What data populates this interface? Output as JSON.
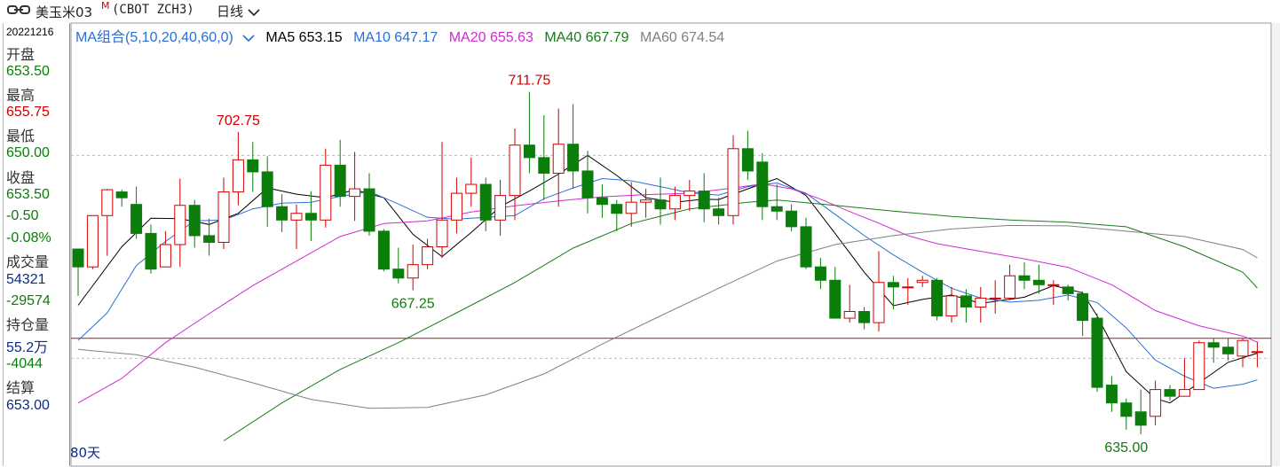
{
  "header": {
    "name": "美玉米03",
    "flag": "M",
    "code": "(CBOT ZCH3)",
    "period": "日线",
    "link_icon": "link-icon",
    "dropdown_icon": "chevron-down-icon"
  },
  "info_panel": {
    "date": "20221216",
    "open_label": "开盘",
    "open": "653.50",
    "high_label": "最高",
    "high": "655.75",
    "low_label": "最低",
    "low": "650.00",
    "close_label": "收盘",
    "close": "653.50",
    "change": "-0.50",
    "change_pct": "-0.08%",
    "volume_label": "成交量",
    "volume": "54321",
    "volume_change": "-29574",
    "oi_label": "持仓量",
    "oi": "55.2万",
    "oi_change": "-4044",
    "settle_label": "结算",
    "settle": "653.00"
  },
  "legend": {
    "selector": "MA组合(5,10,20,40,60,0)",
    "ma5": "MA5 653.15",
    "ma10": "MA10 647.17",
    "ma20": "MA20 655.63",
    "ma40": "MA40 667.79",
    "ma60": "MA60 674.54"
  },
  "footer": {
    "days": "80天"
  },
  "colors": {
    "up": "#d00000",
    "down": "#0a7d0a",
    "ma5": "#000000",
    "ma10": "#2a6fd6",
    "ma20": "#d12bd1",
    "ma40": "#1a7a1a",
    "ma60": "#808080",
    "ref_line": "#9c1c1c"
  },
  "chart_data": {
    "type": "candlestick",
    "y_range": [
      633,
      722
    ],
    "reference_price": 656.5,
    "grid_y": [
      697.5,
      652.0
    ],
    "annotations": [
      {
        "label": "702.75",
        "index": 11,
        "value": 702.75,
        "color": "red"
      },
      {
        "label": "711.75",
        "index": 31,
        "value": 711.75,
        "color": "red"
      },
      {
        "label": "667.25",
        "index": 23,
        "value": 667.25,
        "color": "green"
      },
      {
        "label": "635.00",
        "index": 72,
        "value": 635.0,
        "color": "green"
      }
    ],
    "candles": [
      [
        676.5,
        672.5,
        676.5,
        666.0
      ],
      [
        672.5,
        684.0,
        684.0,
        672.0
      ],
      [
        684.0,
        689.8,
        690.0,
        675.0
      ],
      [
        689.3,
        688.0,
        689.8,
        686.0
      ],
      [
        686.5,
        680.0,
        690.5,
        678.8
      ],
      [
        680.0,
        672.0,
        682.0,
        671.0
      ],
      [
        672.5,
        677.5,
        680.5,
        672.5
      ],
      [
        677.5,
        686.3,
        692.3,
        672.5
      ],
      [
        686.3,
        679.5,
        687.5,
        676.8
      ],
      [
        679.5,
        678.0,
        683.3,
        675.0
      ],
      [
        678.0,
        689.3,
        692.5,
        676.5
      ],
      [
        689.3,
        696.5,
        702.75,
        686.3
      ],
      [
        696.5,
        693.8,
        700.5,
        689.3
      ],
      [
        693.8,
        686.0,
        697.3,
        681.5
      ],
      [
        686.0,
        683.0,
        688.8,
        680.3
      ],
      [
        683.0,
        684.5,
        686.5,
        676.5
      ],
      [
        684.5,
        683.0,
        689.5,
        678.3
      ],
      [
        683.0,
        695.3,
        699.0,
        681.3
      ],
      [
        695.3,
        688.3,
        701.0,
        686.0
      ],
      [
        688.3,
        690.0,
        698.3,
        682.8
      ],
      [
        690.0,
        680.5,
        693.5,
        679.5
      ],
      [
        680.5,
        672.0,
        681.0,
        671.5
      ],
      [
        672.0,
        670.0,
        676.8,
        668.8
      ],
      [
        670.0,
        673.0,
        677.5,
        667.25
      ],
      [
        673.0,
        677.0,
        678.8,
        672.0
      ],
      [
        677.0,
        683.0,
        700.5,
        674.5
      ],
      [
        683.0,
        689.0,
        692.5,
        680.0
      ],
      [
        689.0,
        691.0,
        697.0,
        686.0
      ],
      [
        691.0,
        683.0,
        692.5,
        680.5
      ],
      [
        683.0,
        688.5,
        692.0,
        679.5
      ],
      [
        688.5,
        699.8,
        703.5,
        683.0
      ],
      [
        699.8,
        697.0,
        711.75,
        693.5
      ],
      [
        697.0,
        693.5,
        706.5,
        687.5
      ],
      [
        693.5,
        700.0,
        708.0,
        686.0
      ],
      [
        700.0,
        694.0,
        709.0,
        690.0
      ],
      [
        694.0,
        688.0,
        698.5,
        684.5
      ],
      [
        688.0,
        686.5,
        691.0,
        683.5
      ],
      [
        686.5,
        684.5,
        687.5,
        680.5
      ],
      [
        684.5,
        687.0,
        691.5,
        681.5
      ],
      [
        687.0,
        687.5,
        690.0,
        683.5
      ],
      [
        687.5,
        685.5,
        692.5,
        682.0
      ],
      [
        685.5,
        688.5,
        690.5,
        683.0
      ],
      [
        688.5,
        689.5,
        692.0,
        685.0
      ],
      [
        689.5,
        685.5,
        693.5,
        682.5
      ],
      [
        685.5,
        684.0,
        688.0,
        682.0
      ],
      [
        684.0,
        699.0,
        702.0,
        682.0
      ],
      [
        699.0,
        694.0,
        703.0,
        692.0
      ],
      [
        696.0,
        686.0,
        698.0,
        683.0
      ],
      [
        686.0,
        685.0,
        691.0,
        683.0
      ],
      [
        685.0,
        681.5,
        686.5,
        680.5
      ],
      [
        681.5,
        672.5,
        683.5,
        672.0
      ],
      [
        672.5,
        669.5,
        674.5,
        667.5
      ],
      [
        669.5,
        661.0,
        672.5,
        661.0
      ],
      [
        661.0,
        662.5,
        668.5,
        660.0
      ],
      [
        662.5,
        660.0,
        663.5,
        658.5
      ],
      [
        660.0,
        669.0,
        676.0,
        658.0
      ],
      [
        669.0,
        668.0,
        670.5,
        663.0
      ],
      [
        668.0,
        668.0,
        670.0,
        664.0
      ],
      [
        669.0,
        669.5,
        670.5,
        668.0
      ],
      [
        669.5,
        661.5,
        670.0,
        660.5
      ],
      [
        661.5,
        666.0,
        668.0,
        660.0
      ],
      [
        666.0,
        663.5,
        667.5,
        660.0
      ],
      [
        663.5,
        665.5,
        668.0,
        660.0
      ],
      [
        665.5,
        665.5,
        669.5,
        662.0
      ],
      [
        665.5,
        670.5,
        673.0,
        665.0
      ],
      [
        670.5,
        669.5,
        673.5,
        667.5
      ],
      [
        669.5,
        668.5,
        673.0,
        666.5
      ],
      [
        668.5,
        668.5,
        669.5,
        664.0
      ],
      [
        668.0,
        666.5,
        668.5,
        665.0
      ],
      [
        666.5,
        660.5,
        667.0,
        657.0
      ],
      [
        661.0,
        645.5,
        662.0,
        644.5
      ],
      [
        646.0,
        642.0,
        648.0,
        640.0
      ],
      [
        642.0,
        639.0,
        643.0,
        636.0
      ],
      [
        640.0,
        637.0,
        645.0,
        635.0
      ],
      [
        639.0,
        645.0,
        647.0,
        637.0
      ],
      [
        645.0,
        643.5,
        646.0,
        642.5
      ],
      [
        643.5,
        645.0,
        652.0,
        643.5
      ],
      [
        645.0,
        655.5,
        656.0,
        645.0
      ],
      [
        655.5,
        654.5,
        656.5,
        651.0
      ],
      [
        654.5,
        653.0,
        656.5,
        651.5
      ],
      [
        652.5,
        656.0,
        656.5,
        650.0
      ],
      [
        653.5,
        653.5,
        655.75,
        650.0
      ]
    ],
    "ma_lines": {
      "MA5": [
        [
          0,
          663.9
        ],
        [
          3,
          677.0
        ],
        [
          5,
          683.4
        ],
        [
          7,
          683.3
        ],
        [
          9,
          682.0
        ],
        [
          11,
          684.5
        ],
        [
          13,
          690.2
        ],
        [
          15,
          688.8
        ],
        [
          17,
          688.0
        ],
        [
          19,
          689.8
        ],
        [
          21,
          688.0
        ],
        [
          23,
          679.8
        ],
        [
          25,
          674.8
        ],
        [
          27,
          680.2
        ],
        [
          29,
          686.0
        ],
        [
          31,
          689.5
        ],
        [
          33,
          693.3
        ],
        [
          35,
          697.5
        ],
        [
          37,
          693.0
        ],
        [
          39,
          688.0
        ],
        [
          41,
          687.0
        ],
        [
          43,
          687.7
        ],
        [
          44,
          687.6
        ],
        [
          46,
          690.0
        ],
        [
          48,
          692.3
        ],
        [
          50,
          688.5
        ],
        [
          52,
          680.0
        ],
        [
          54,
          671.3
        ],
        [
          56,
          663.8
        ],
        [
          58,
          665.2
        ],
        [
          60,
          666.2
        ],
        [
          62,
          664.3
        ],
        [
          65,
          665.7
        ],
        [
          67,
          668.3
        ],
        [
          69,
          666.7
        ],
        [
          70,
          661.5
        ],
        [
          72,
          649.0
        ],
        [
          74,
          643.0
        ],
        [
          75,
          642.0
        ],
        [
          77,
          646.5
        ],
        [
          79,
          651.1
        ],
        [
          81,
          653.15
        ]
      ],
      "MA10": [
        [
          0,
          656.0
        ],
        [
          2,
          662.2
        ],
        [
          4,
          672.8
        ],
        [
          6,
          678.2
        ],
        [
          8,
          682.8
        ],
        [
          10,
          683.0
        ],
        [
          12,
          685.5
        ],
        [
          14,
          686.8
        ],
        [
          16,
          687.0
        ],
        [
          18,
          688.3
        ],
        [
          20,
          689.4
        ],
        [
          22,
          686.6
        ],
        [
          24,
          683.6
        ],
        [
          26,
          683.2
        ],
        [
          28,
          683.6
        ],
        [
          30,
          684.0
        ],
        [
          32,
          687.8
        ],
        [
          34,
          690.2
        ],
        [
          36,
          692.3
        ],
        [
          38,
          691.8
        ],
        [
          40,
          690.5
        ],
        [
          42,
          689.1
        ],
        [
          44,
          688.6
        ],
        [
          46,
          690.5
        ],
        [
          48,
          691.3
        ],
        [
          50,
          689.0
        ],
        [
          52,
          684.3
        ],
        [
          54,
          679.5
        ],
        [
          56,
          675.2
        ],
        [
          58,
          671.3
        ],
        [
          60,
          667.7
        ],
        [
          62,
          665.5
        ],
        [
          64,
          664.6
        ],
        [
          66,
          665.0
        ],
        [
          68,
          666.2
        ],
        [
          70,
          664.5
        ],
        [
          72,
          658.8
        ],
        [
          74,
          651.6
        ],
        [
          76,
          648.0
        ],
        [
          78,
          645.3
        ],
        [
          80,
          646.2
        ],
        [
          81,
          647.17
        ]
      ],
      "MA20": [
        [
          0,
          642.0
        ],
        [
          3,
          647.5
        ],
        [
          6,
          655.5
        ],
        [
          9,
          662.0
        ],
        [
          12,
          668.3
        ],
        [
          15,
          673.8
        ],
        [
          18,
          679.3
        ],
        [
          21,
          682.2
        ],
        [
          24,
          682.8
        ],
        [
          27,
          684.8
        ],
        [
          30,
          686.2
        ],
        [
          33,
          687.3
        ],
        [
          36,
          688.2
        ],
        [
          39,
          688.7
        ],
        [
          42,
          689.0
        ],
        [
          45,
          690.2
        ],
        [
          47,
          691.1
        ],
        [
          49,
          690.0
        ],
        [
          51,
          687.7
        ],
        [
          53,
          684.9
        ],
        [
          55,
          682.3
        ],
        [
          57,
          679.5
        ],
        [
          59,
          677.7
        ],
        [
          62,
          676.0
        ],
        [
          65,
          674.3
        ],
        [
          68,
          672.4
        ],
        [
          71,
          668.5
        ],
        [
          74,
          662.7
        ],
        [
          77,
          659.3
        ],
        [
          80,
          657.0
        ],
        [
          81,
          655.63
        ]
      ],
      "MA40": [
        [
          10,
          633.5
        ],
        [
          14,
          642.0
        ],
        [
          18,
          649.5
        ],
        [
          22,
          655.5
        ],
        [
          26,
          662.2
        ],
        [
          30,
          669.0
        ],
        [
          34,
          676.7
        ],
        [
          38,
          682.2
        ],
        [
          42,
          685.5
        ],
        [
          46,
          687.0
        ],
        [
          48,
          687.5
        ],
        [
          52,
          686.3
        ],
        [
          56,
          685.0
        ],
        [
          60,
          683.8
        ],
        [
          64,
          683.0
        ],
        [
          68,
          682.5
        ],
        [
          72,
          681.5
        ],
        [
          76,
          677.0
        ],
        [
          80,
          671.3
        ],
        [
          81,
          667.79
        ]
      ],
      "MA60": [
        [
          0,
          654.0
        ],
        [
          4,
          652.8
        ],
        [
          8,
          650.0
        ],
        [
          12,
          646.5
        ],
        [
          16,
          642.8
        ],
        [
          20,
          640.8
        ],
        [
          24,
          641.0
        ],
        [
          28,
          643.8
        ],
        [
          32,
          648.5
        ],
        [
          36,
          655.2
        ],
        [
          40,
          661.5
        ],
        [
          44,
          667.7
        ],
        [
          48,
          673.8
        ],
        [
          52,
          677.5
        ],
        [
          56,
          679.5
        ],
        [
          60,
          681.0
        ],
        [
          64,
          681.8
        ],
        [
          68,
          681.7
        ],
        [
          72,
          680.5
        ],
        [
          76,
          679.3
        ],
        [
          80,
          676.4
        ],
        [
          81,
          674.54
        ]
      ]
    }
  }
}
